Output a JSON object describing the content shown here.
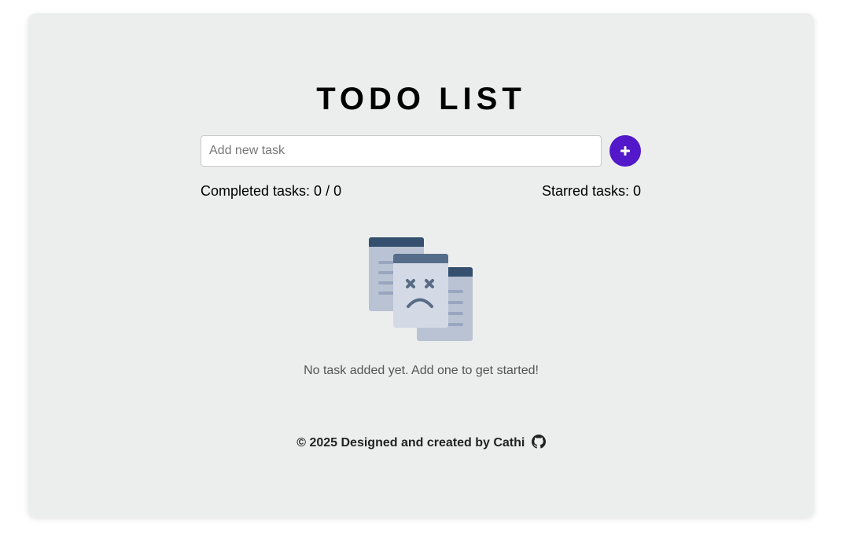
{
  "app": {
    "title": "TODO LIST"
  },
  "new_task": {
    "placeholder": "Add new task",
    "value": "",
    "add_icon": "plus-icon"
  },
  "stats": {
    "completed_label": "Completed tasks: 0 / 0",
    "starred_label": "Starred tasks: 0"
  },
  "empty_state": {
    "icon": "empty-tasks-illustration",
    "message": "No task added yet. Add one to get started!"
  },
  "footer": {
    "text": "© 2025 Designed and created by Cathi",
    "link_icon": "github-icon"
  },
  "colors": {
    "accent": "#5218c9",
    "card_background": "#eceeee"
  }
}
